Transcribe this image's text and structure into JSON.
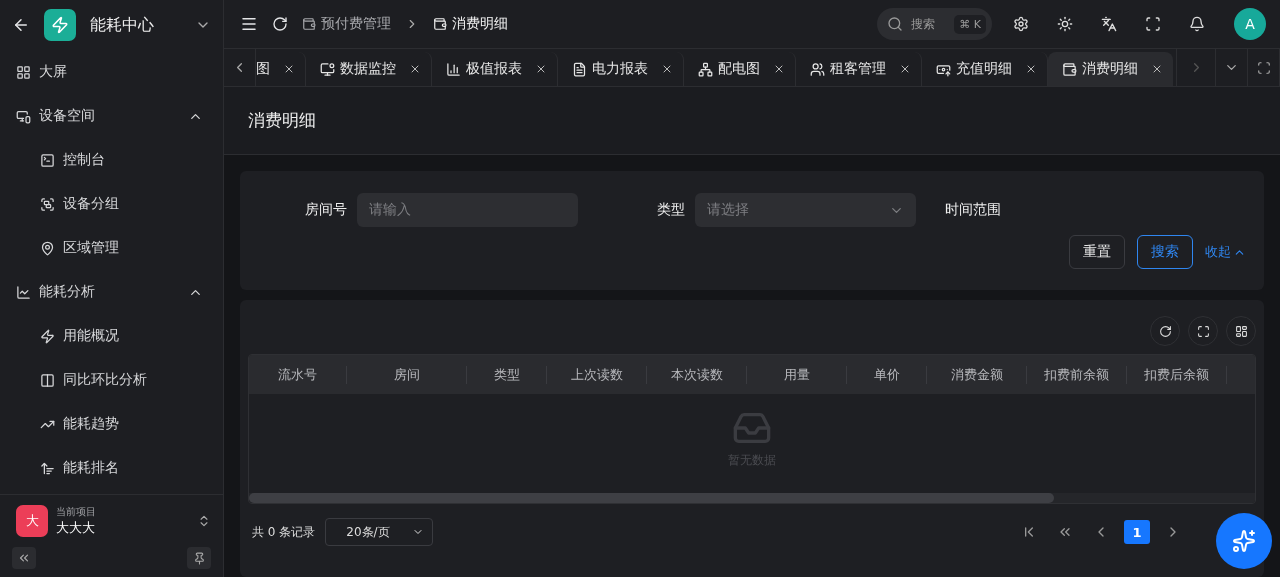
{
  "sidebar": {
    "app_name": "能耗中心",
    "menu": [
      {
        "kind": "item",
        "label": "大屏"
      },
      {
        "kind": "group",
        "label": "设备空间",
        "expanded": true,
        "children": [
          {
            "label": "控制台"
          },
          {
            "label": "设备分组"
          },
          {
            "label": "区域管理"
          }
        ]
      },
      {
        "kind": "group",
        "label": "能耗分析",
        "expanded": true,
        "children": [
          {
            "label": "用能概况"
          },
          {
            "label": "同比环比分析"
          },
          {
            "label": "能耗趋势"
          },
          {
            "label": "能耗排名"
          }
        ]
      }
    ],
    "project": {
      "avatar": "大",
      "caption": "当前项目",
      "name": "大大大"
    }
  },
  "header": {
    "breadcrumb": [
      "预付费管理",
      "消费明细"
    ],
    "search": {
      "placeholder": "搜索",
      "shortcut": "⌘ K"
    },
    "avatar": "A"
  },
  "tabs": [
    {
      "label": "图",
      "selected": false
    },
    {
      "label": "数据监控",
      "selected": false
    },
    {
      "label": "极值报表",
      "selected": false
    },
    {
      "label": "电力报表",
      "selected": false
    },
    {
      "label": "配电图",
      "selected": false
    },
    {
      "label": "租客管理",
      "selected": false
    },
    {
      "label": "充值明细",
      "selected": false
    },
    {
      "label": "消费明细",
      "selected": true
    }
  ],
  "page_title": "消费明细",
  "filters": [
    {
      "kind": "input",
      "label": "房间号",
      "placeholder": "请输入"
    },
    {
      "kind": "select",
      "label": "类型",
      "placeholder": "请选择"
    },
    {
      "kind": "label",
      "label": "时间范围"
    }
  ],
  "filter_buttons": {
    "reset": "重置",
    "search": "搜索",
    "collapse": "收起"
  },
  "table": {
    "columns": [
      "流水号",
      "房间",
      "类型",
      "上次读数",
      "本次读数",
      "用量",
      "单价",
      "消费金额",
      "扣费前余额",
      "扣费后余额"
    ],
    "empty_text": "暂无数据"
  },
  "pagination": {
    "total": "共 0 条记录",
    "page_size": "20条/页",
    "pages": [
      {
        "label": "1",
        "selected": true
      }
    ]
  }
}
